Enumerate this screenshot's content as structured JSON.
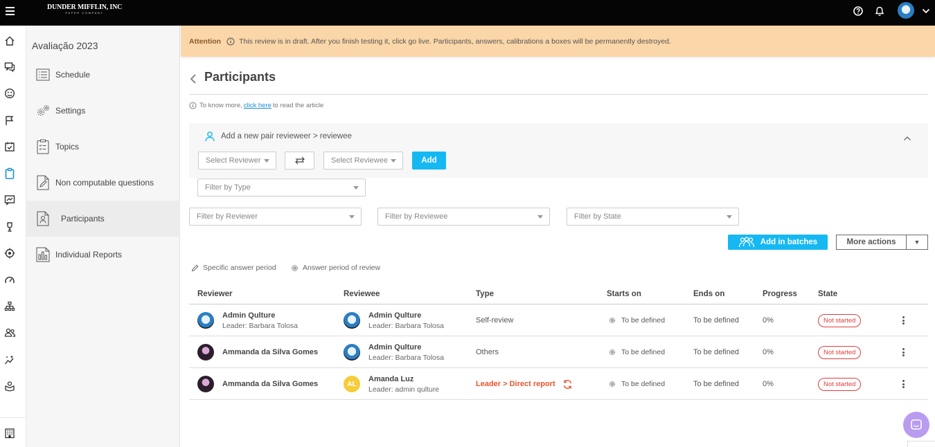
{
  "brand": {
    "line1": "DUNDER MIFFLIN, INC",
    "line2": "PAPER COMPANY"
  },
  "subnav": {
    "title": "Avaliação 2023",
    "items": [
      {
        "label": "Schedule",
        "icon": "list-icon"
      },
      {
        "label": "Settings",
        "icon": "gears-icon"
      },
      {
        "label": "Topics",
        "icon": "clipboard-check-icon"
      },
      {
        "label": "Non computable questions",
        "icon": "pencil-doc-icon"
      },
      {
        "label": "Participants",
        "icon": "user-doc-icon",
        "active": true
      },
      {
        "label": "Individual Reports",
        "icon": "chart-doc-icon"
      }
    ]
  },
  "attention": {
    "label": "Attention",
    "message": "This review is in draft. After you finish testing it, click go live. Participants, answers, calibrations a boxes will be permanently destroyed."
  },
  "page": {
    "title": "Participants",
    "info_prefix": "To know more,",
    "info_link": "click here",
    "info_suffix": "to read the article"
  },
  "pair": {
    "title": "Add a new pair revieweer > reviewee",
    "select_reviewer": "Select Reviewer",
    "select_reviewee": "Select Reviewee",
    "add_label": "Add",
    "filter_type": "Filter by Type"
  },
  "filters": {
    "reviewer": "Filter by Reviewer",
    "reviewee": "Filter by Reviewee",
    "state": "Filter by State"
  },
  "actions": {
    "batches": "Add in batches",
    "more": "More actions",
    "more_arrow": "▼"
  },
  "periods": {
    "specific": "Specific answer period",
    "review": "Answer period of review"
  },
  "table": {
    "headers": [
      "Reviewer",
      "Reviewee",
      "Type",
      "Starts on",
      "Ends on",
      "Progress",
      "State"
    ],
    "rows": [
      {
        "reviewer": {
          "name": "Admin Qulture",
          "leader": "Leader: Barbara Tolosa",
          "avatar": "admin"
        },
        "reviewee": {
          "name": "Admin Qulture",
          "leader": "Leader: Barbara Tolosa",
          "avatar": "admin"
        },
        "type": "Self-review",
        "starts": "To be defined",
        "ends": "To be defined",
        "progress": "0%",
        "state": "Not started"
      },
      {
        "reviewer": {
          "name": "Ammanda da Silva Gomes",
          "leader": "",
          "avatar": "ammanda"
        },
        "reviewee": {
          "name": "Admin Qulture",
          "leader": "Leader: Barbara Tolosa",
          "avatar": "admin"
        },
        "type": "Others",
        "starts": "To be defined",
        "ends": "To be defined",
        "progress": "0%",
        "state": "Not started"
      },
      {
        "reviewer": {
          "name": "Ammanda da Silva Gomes",
          "leader": "",
          "avatar": "ammanda"
        },
        "reviewee": {
          "name": "Amanda Luz",
          "leader": "Leader: admin qulture",
          "avatar": "initials",
          "initials": "AL"
        },
        "type": "Leader > Direct report",
        "starts": "To be defined",
        "ends": "To be defined",
        "progress": "0%",
        "state": "Not started"
      }
    ]
  },
  "colors": {
    "accent": "#16b8f2",
    "attention_bg": "#fbd6a8",
    "danger": "#e23c3c",
    "type_highlight": "#e8542e",
    "chat": "#b99bf0"
  }
}
